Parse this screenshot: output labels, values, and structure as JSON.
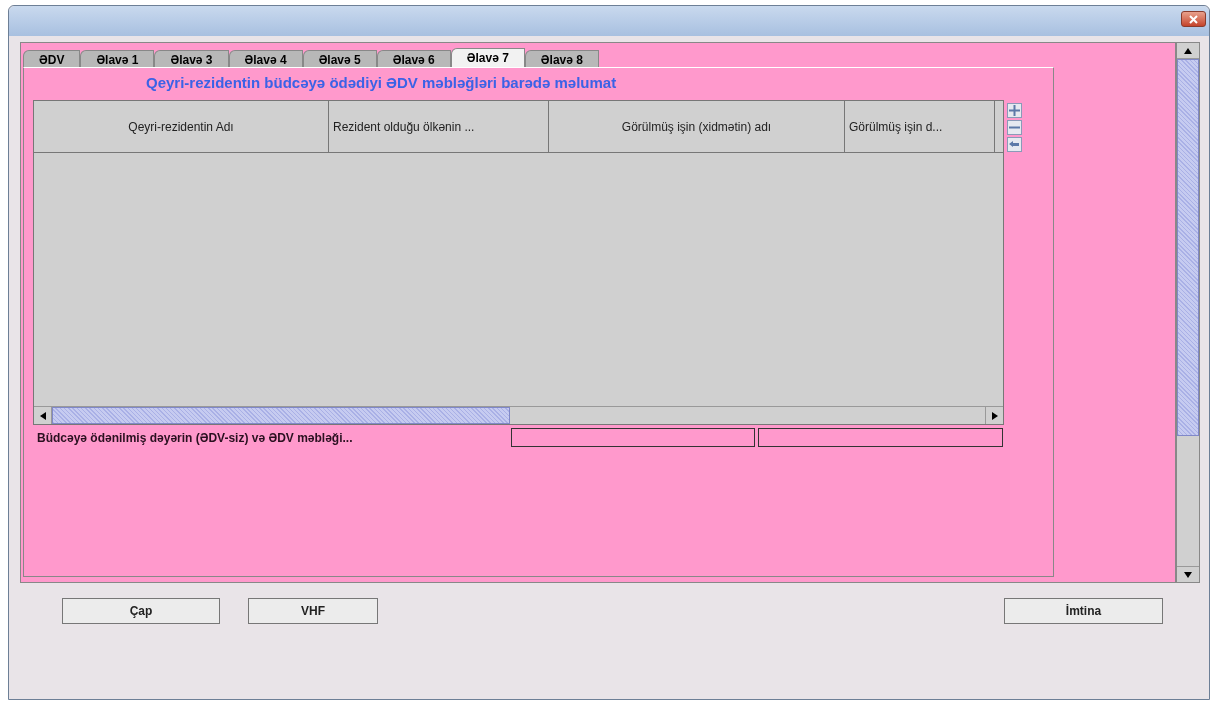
{
  "tabs": [
    {
      "label": "ƏDV",
      "selected": false
    },
    {
      "label": "Əlavə 1",
      "selected": false
    },
    {
      "label": "Əlavə 3",
      "selected": false
    },
    {
      "label": "Əlavə 4",
      "selected": false
    },
    {
      "label": "Əlavə 5",
      "selected": false
    },
    {
      "label": "Əlavə 6",
      "selected": false
    },
    {
      "label": "Əlavə 7",
      "selected": true
    },
    {
      "label": "Əlavə 8",
      "selected": false
    }
  ],
  "panel_title": "Qeyri-rezidentin büdcəyə ödədiyi ƏDV məbləğləri barədə məlumat",
  "table": {
    "columns": [
      "Qeyri-rezidentin Adı",
      "Rezident olduğu ölkənin ...",
      "Görülmüş işin (xidmətin) adı",
      "Görülmüş işin d..."
    ]
  },
  "summary": {
    "label": "Büdcəyə ödənilmiş dəyərin (ƏDV-siz) və ƏDV məbləği..."
  },
  "buttons": [
    "Çap",
    "VHF",
    "İmtina"
  ]
}
